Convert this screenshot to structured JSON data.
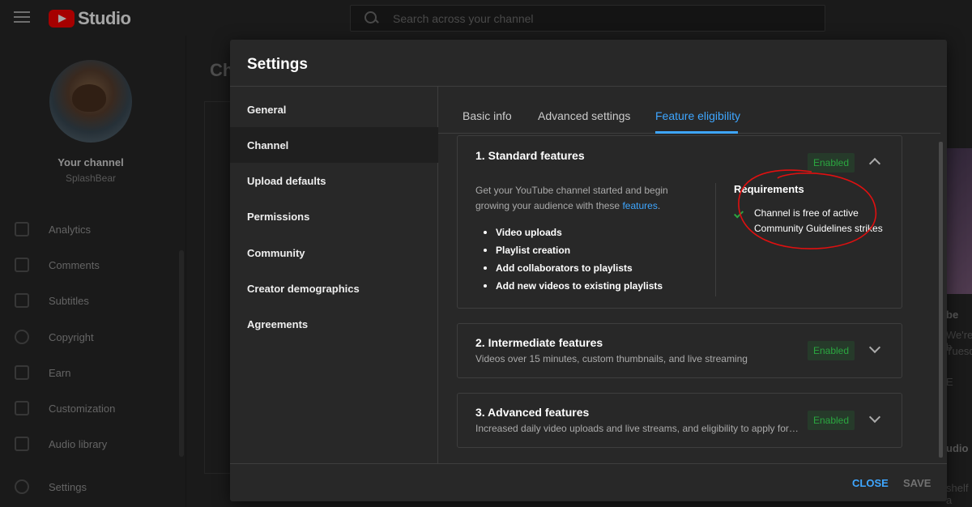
{
  "topbar": {
    "app_name": "Studio",
    "search_placeholder": "Search across your channel"
  },
  "leftnav": {
    "channel_title": "Your channel",
    "channel_handle": "SplashBear",
    "items": [
      {
        "label": "Analytics",
        "icon": "analytics-icon"
      },
      {
        "label": "Comments",
        "icon": "comments-icon"
      },
      {
        "label": "Subtitles",
        "icon": "subtitles-icon"
      },
      {
        "label": "Copyright",
        "icon": "copyright-icon"
      },
      {
        "label": "Earn",
        "icon": "earn-icon"
      },
      {
        "label": "Customization",
        "icon": "customization-icon"
      },
      {
        "label": "Audio library",
        "icon": "audio-library-icon"
      },
      {
        "label": "Settings",
        "icon": "settings-icon"
      }
    ]
  },
  "background": {
    "page_title": "Ch",
    "right_snippets": [
      "be",
      "We're b",
      "Tuesd",
      "E",
      "udio",
      "shelf a"
    ]
  },
  "modal": {
    "title": "Settings",
    "side_items": [
      {
        "label": "General",
        "active": false
      },
      {
        "label": "Channel",
        "active": true
      },
      {
        "label": "Upload defaults",
        "active": false
      },
      {
        "label": "Permissions",
        "active": false
      },
      {
        "label": "Community",
        "active": false
      },
      {
        "label": "Creator demographics",
        "active": false
      },
      {
        "label": "Agreements",
        "active": false
      }
    ],
    "tabs": [
      {
        "label": "Basic info",
        "active": false
      },
      {
        "label": "Advanced settings",
        "active": false
      },
      {
        "label": "Feature eligibility",
        "active": true
      }
    ],
    "panels": {
      "standard": {
        "title": "1. Standard features",
        "badge": "Enabled",
        "desc_prefix": "Get your YouTube channel started and begin growing your audience with these ",
        "desc_link": "features",
        "desc_suffix": ".",
        "features": [
          "Video uploads",
          "Playlist creation",
          "Add collaborators to playlists",
          "Add new videos to existing playlists"
        ],
        "requirements_title": "Requirements",
        "requirement": "Channel is free of active Community Guidelines strikes"
      },
      "intermediate": {
        "title": "2. Intermediate features",
        "subtitle": "Videos over 15 minutes, custom thumbnails, and live streaming",
        "badge": "Enabled"
      },
      "advanced": {
        "title": "3. Advanced features",
        "subtitle": "Increased daily video uploads and live streams, and eligibility to apply for ...",
        "badge": "Enabled"
      }
    },
    "footer": {
      "close_label": "CLOSE",
      "save_label": "SAVE"
    }
  },
  "colors": {
    "accent": "#3ea6ff",
    "enabled": "#2ba640",
    "annotation": "#e01010"
  }
}
